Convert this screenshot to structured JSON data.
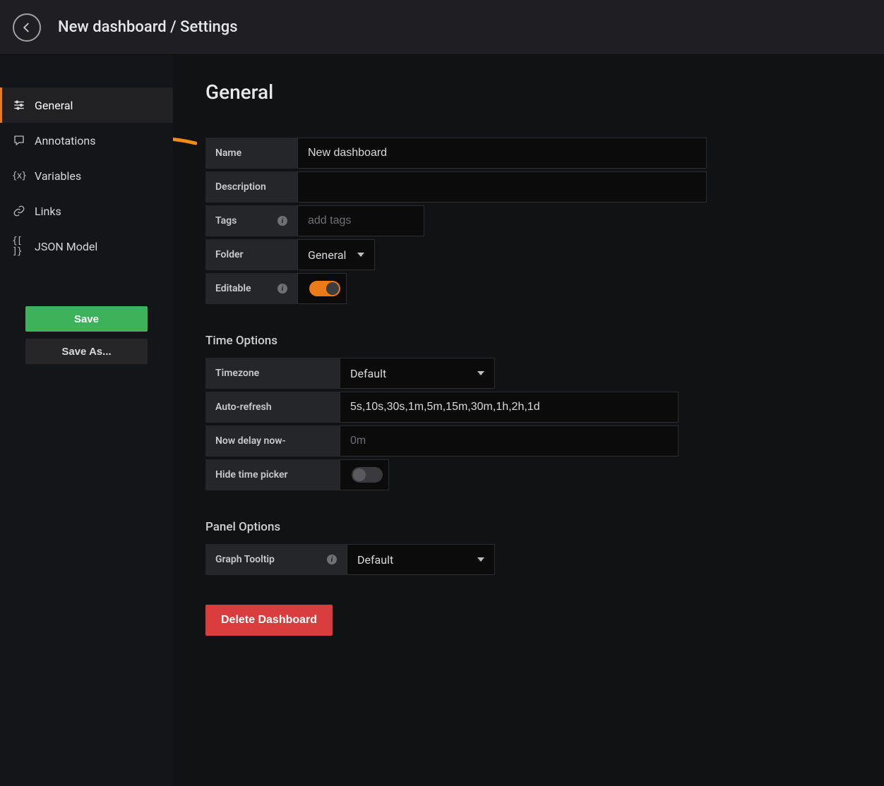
{
  "header": {
    "breadcrumb": "New dashboard / Settings"
  },
  "sidebar": {
    "items": [
      {
        "label": "General"
      },
      {
        "label": "Annotations"
      },
      {
        "label": "Variables"
      },
      {
        "label": "Links"
      },
      {
        "label": "JSON Model"
      }
    ],
    "save_label": "Save",
    "save_as_label": "Save As..."
  },
  "page": {
    "title": "General",
    "form": {
      "name_label": "Name",
      "name_value": "New dashboard",
      "description_label": "Description",
      "description_value": "",
      "tags_label": "Tags",
      "tags_placeholder": "add tags",
      "folder_label": "Folder",
      "folder_value": "General",
      "editable_label": "Editable",
      "editable_on": true
    },
    "time": {
      "section": "Time Options",
      "timezone_label": "Timezone",
      "timezone_value": "Default",
      "autorefresh_label": "Auto-refresh",
      "autorefresh_value": "5s,10s,30s,1m,5m,15m,30m,1h,2h,1d",
      "nowdelay_label": "Now delay now-",
      "nowdelay_placeholder": "0m",
      "hidetp_label": "Hide time picker",
      "hidetp_on": false
    },
    "panel": {
      "section": "Panel Options",
      "tooltip_label": "Graph Tooltip",
      "tooltip_value": "Default"
    },
    "delete_label": "Delete Dashboard"
  }
}
